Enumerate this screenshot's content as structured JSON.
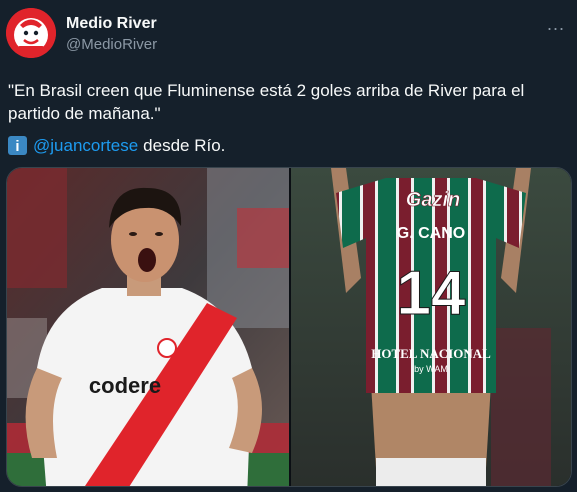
{
  "tweet": {
    "author_name": "Medio River",
    "author_handle": "@MedioRiver",
    "more_icon": "...",
    "text": "\"En Brasil creen que Fluminense está 2 goles arriba de River para el partido de mañana.\"",
    "mention": "@juancortese",
    "location_text": "desde Río.",
    "info_icon": "i"
  },
  "media": {
    "left_jersey_sponsor": "codere",
    "right_jersey_sponsor": "Gazin",
    "right_jersey_name": "G. CANO",
    "right_jersey_number": "14",
    "right_jersey_bottom_sponsor": "HOTEL NACIONAL",
    "right_jersey_bottom_sub": "by WAM"
  },
  "colors": {
    "background": "#15202b",
    "text": "#f7f9f9",
    "secondary": "#8b98a5",
    "link": "#1d9bf0",
    "river_red": "#e0242b",
    "flu_maroon": "#7a1e2e",
    "flu_green": "#0e6b4c"
  }
}
